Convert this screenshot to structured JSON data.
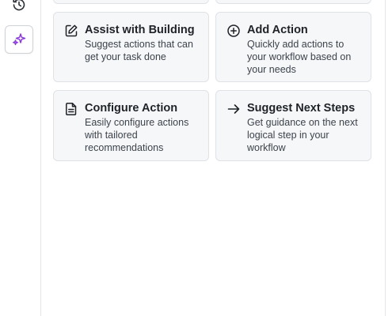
{
  "sidebar": {
    "icons": [
      {
        "name": "history-icon"
      },
      {
        "name": "copilot-sparkle-icon",
        "active": true,
        "color": "#8b3fd9"
      }
    ]
  },
  "cards": [
    {
      "title": "Assist with Building",
      "description": "Suggest actions that can get your task done",
      "icon": "edit-square-icon"
    },
    {
      "title": "Add Action",
      "description": "Quickly add actions to your workflow based on your needs",
      "icon": "plus-circle-icon"
    },
    {
      "title": "Configure Action",
      "description": "Easily configure actions with tailored recommendations",
      "icon": "document-icon"
    },
    {
      "title": "Suggest Next Steps",
      "description": "Get guidance on the next logical step in your workflow",
      "icon": "arrow-right-icon"
    }
  ],
  "colors": {
    "card_bg": "#f6f7f9",
    "card_border": "#dfe2e6",
    "accent": "#8b3fd9"
  }
}
